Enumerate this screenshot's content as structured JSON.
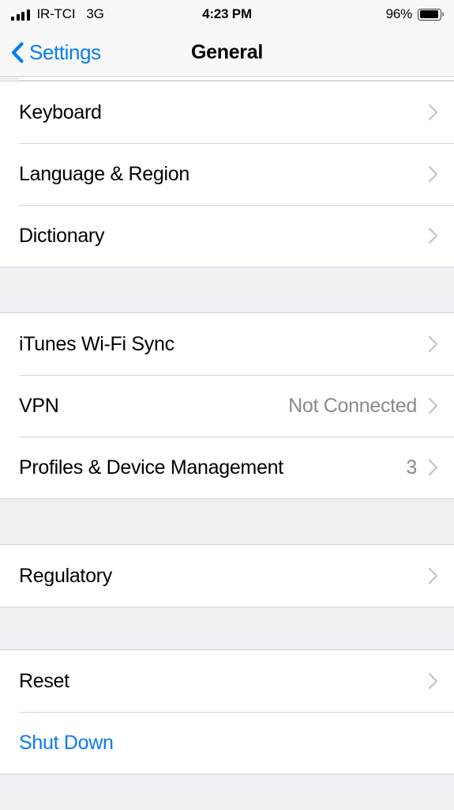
{
  "status_bar": {
    "carrier": "IR-TCI",
    "network": "3G",
    "time": "4:23 PM",
    "battery_percent": "96%",
    "battery_level": 96,
    "signal_bars": 4,
    "signal_icon": "cellular-signal-icon",
    "battery_icon": "battery-icon"
  },
  "nav_bar": {
    "back_label": "Settings",
    "back_icon": "chevron-left-icon",
    "title": "General"
  },
  "colors": {
    "accent": "#0a7cf0",
    "background": "#EFEFF4",
    "row_background": "#FFFFFF",
    "separator": "#d6d6da",
    "detail_text": "#8a8a8e",
    "primary_text": "#000000"
  },
  "sections": [
    {
      "rows": [
        {
          "label": "Keyboard",
          "detail": "",
          "accent": false,
          "chevron": true
        },
        {
          "label": "Language & Region",
          "detail": "",
          "accent": false,
          "chevron": true
        },
        {
          "label": "Dictionary",
          "detail": "",
          "accent": false,
          "chevron": true
        }
      ]
    },
    {
      "rows": [
        {
          "label": "iTunes Wi-Fi Sync",
          "detail": "",
          "accent": false,
          "chevron": true
        },
        {
          "label": "VPN",
          "detail": "Not Connected",
          "accent": false,
          "chevron": true
        },
        {
          "label": "Profiles & Device Management",
          "detail": "3",
          "accent": false,
          "chevron": true
        }
      ]
    },
    {
      "rows": [
        {
          "label": "Regulatory",
          "detail": "",
          "accent": false,
          "chevron": true
        }
      ]
    },
    {
      "rows": [
        {
          "label": "Reset",
          "detail": "",
          "accent": false,
          "chevron": true
        },
        {
          "label": "Shut Down",
          "detail": "",
          "accent": true,
          "chevron": false
        }
      ]
    }
  ]
}
